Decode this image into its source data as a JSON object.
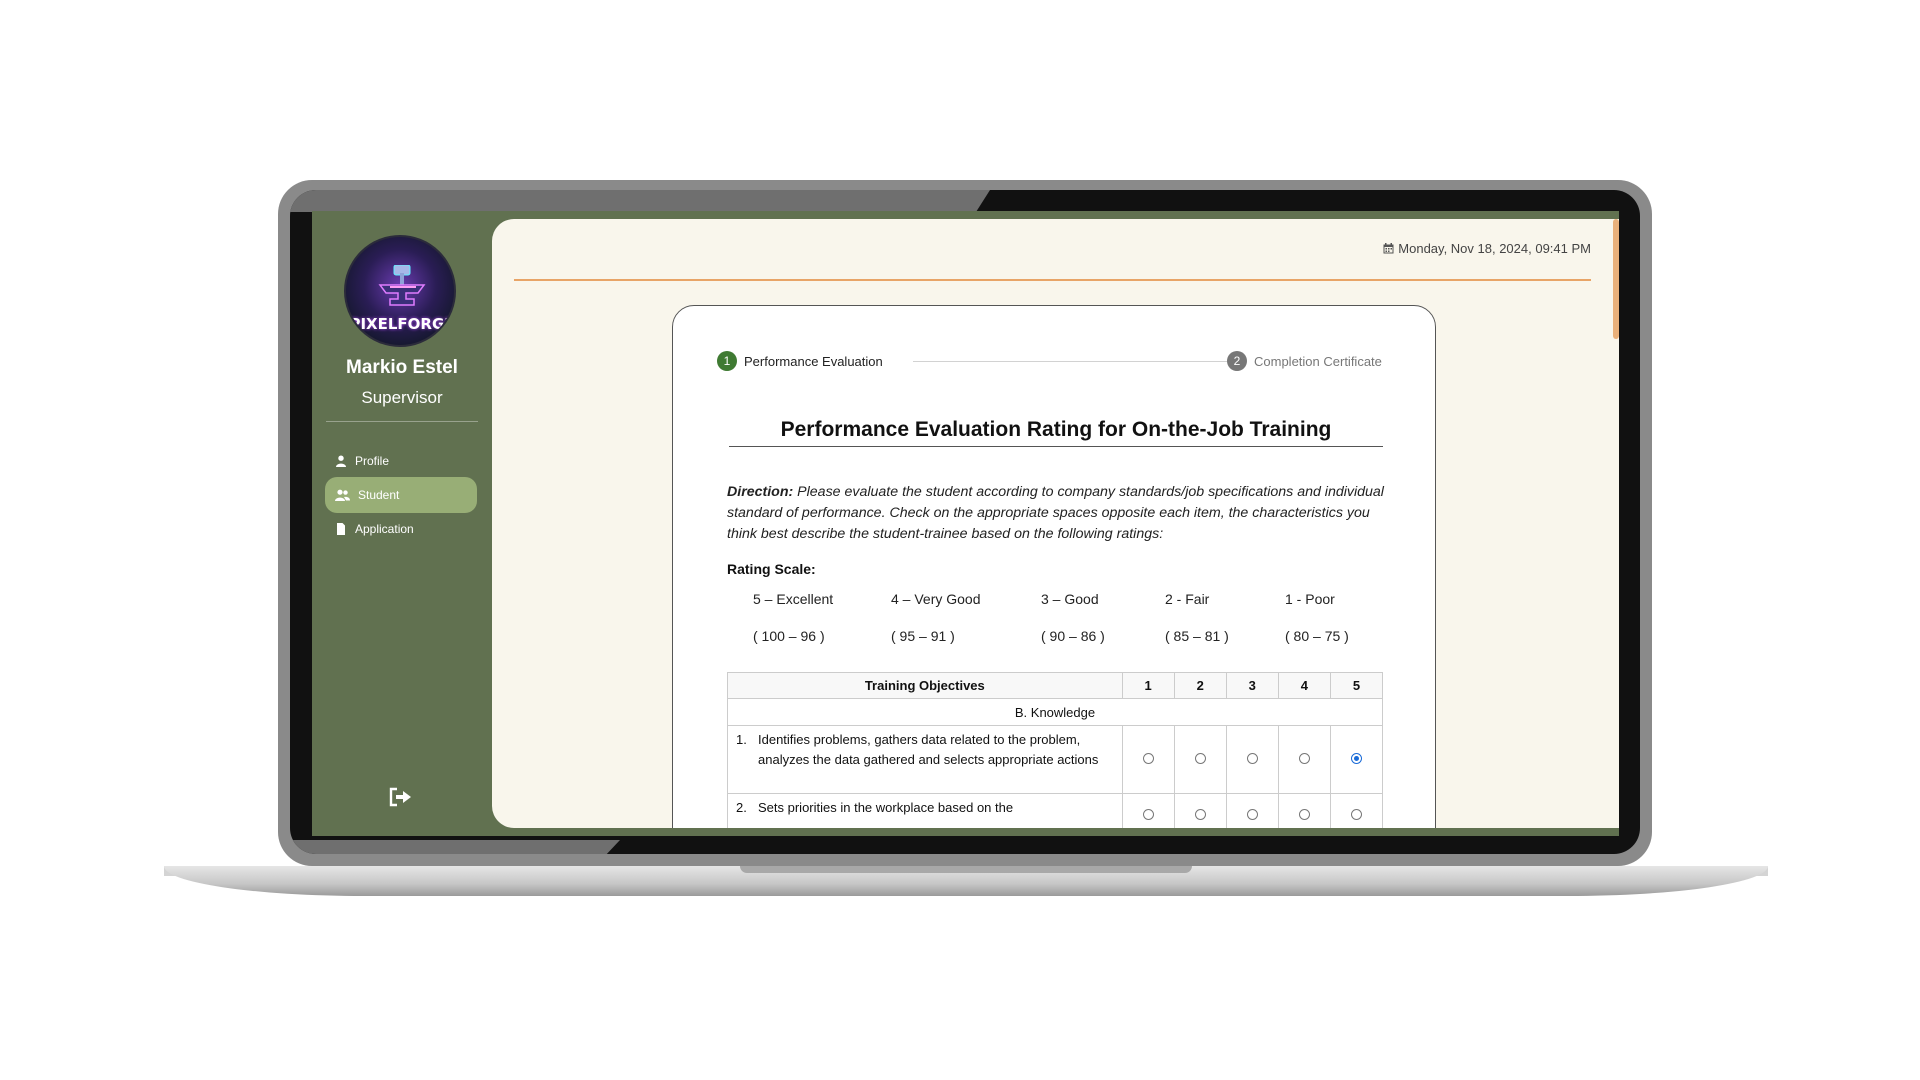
{
  "user": {
    "logo_text": "PIXELFORGE",
    "name": "Markio Estel",
    "role": "Supervisor"
  },
  "sidebar": {
    "items": [
      {
        "label": "Profile",
        "icon": "user-icon",
        "active": false
      },
      {
        "label": "Student",
        "icon": "users-icon",
        "active": true
      },
      {
        "label": "Application",
        "icon": "file-icon",
        "active": false
      }
    ],
    "logout_icon": "sign-out-icon"
  },
  "header": {
    "datetime": "Monday, Nov 18, 2024, 09:41 PM",
    "calendar_icon": "calendar-icon"
  },
  "steps": [
    {
      "number": "1",
      "label": "Performance Evaluation",
      "state": "active",
      "color": "#3f7a32"
    },
    {
      "number": "2",
      "label": "Completion Certificate",
      "state": "inactive",
      "color": "#777777"
    }
  ],
  "form": {
    "title": "Performance Evaluation Rating for On-the-Job Training",
    "direction_label": "Direction:",
    "direction_text": "Please evaluate the student according to company standards/job specifications and individual standard of performance. Check on the appropriate spaces opposite each item, the characteristics you think best describe the student-trainee based on the following ratings:",
    "rating_scale_label": "Rating Scale:",
    "rating_scale": [
      {
        "label": "5 – Excellent",
        "range": "( 100 – 96 )"
      },
      {
        "label": "4 – Very Good",
        "range": "( 95 – 91 )"
      },
      {
        "label": "3 – Good",
        "range": "( 90 – 86 )"
      },
      {
        "label": "2 - Fair",
        "range": "( 85 – 81 )"
      },
      {
        "label": "1 - Poor",
        "range": "( 80 – 75 )"
      }
    ],
    "table": {
      "headers": [
        "Training Objectives",
        "1",
        "2",
        "3",
        "4",
        "5"
      ],
      "section": "B. Knowledge",
      "rows": [
        {
          "num": "1.",
          "text": "Identifies problems, gathers data related to the problem, analyzes the data gathered and selects appropriate actions",
          "selected": 5
        },
        {
          "num": "2.",
          "text": "Sets priorities in the workplace based on the",
          "selected": null
        }
      ]
    }
  },
  "colors": {
    "sidebar_bg": "#617150",
    "sidebar_active": "#98ae76",
    "main_bg": "#f9f6ec",
    "accent_line": "#e8a467",
    "radio_checked": "#1a6bd8"
  }
}
